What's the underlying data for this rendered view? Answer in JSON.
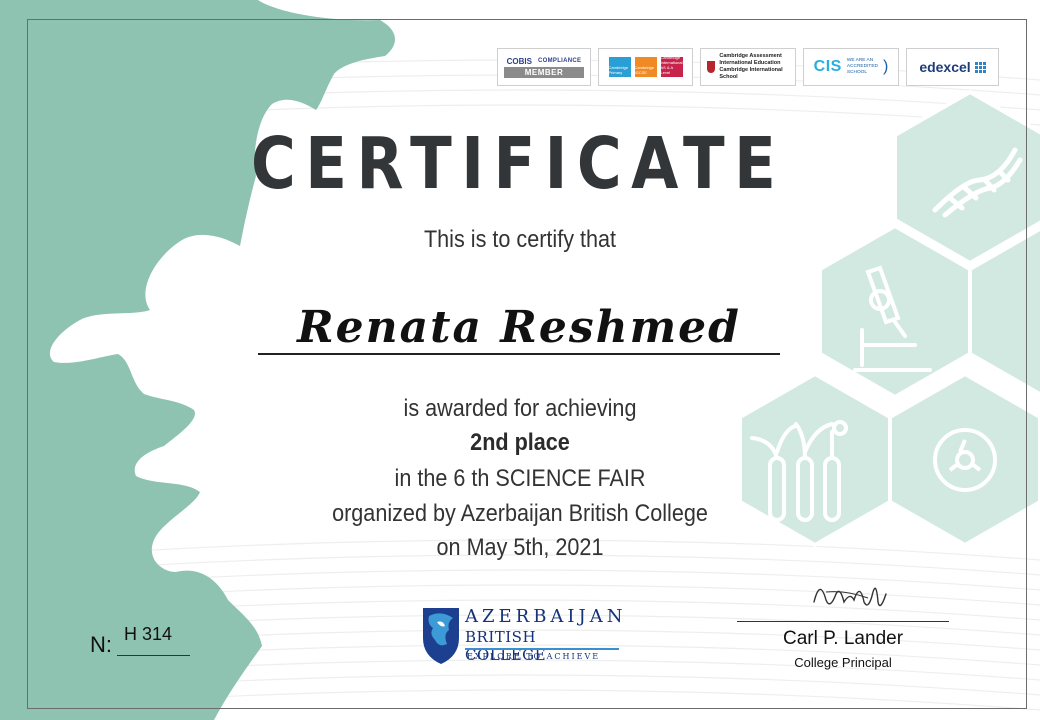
{
  "accreditations": {
    "cobis": {
      "name": "COBIS",
      "compliance": "COMPLIANCE",
      "member": "MEMBER"
    },
    "cambridge_chips": [
      "Cambridge Primary",
      "Cambridge IGCSE",
      "Cambridge International AS & A Level"
    ],
    "cambridge_assessment": {
      "line1": "Cambridge Assessment",
      "line2": "International Education",
      "line3": "Cambridge International School"
    },
    "cis": {
      "mark": "CIS",
      "line1": "WE ARE AN",
      "line2": "ACCREDITED",
      "line3": "SCHOOL",
      "paren": ")"
    },
    "edexcel": "edexcel"
  },
  "certificate": {
    "title": "CERTIFICATE",
    "intro": "This is to certify that",
    "recipient": "Renata Reshmed",
    "line1": "is awarded for achieving",
    "award": "2nd place",
    "line2": "in the 6 th SCIENCE FAIR",
    "line3": "organized by Azerbaijan British College",
    "line4": "on May 5th, 2021"
  },
  "number": {
    "label": "N:",
    "value": "H 314"
  },
  "college_logo": {
    "line1": "AZERBAIJAN",
    "line2": "BRITISH COLLEGE",
    "line3": "EXPLORE TO ACHIEVE"
  },
  "signatory": {
    "name": "Carl P. Lander",
    "role": "College Principal"
  },
  "colors": {
    "accent": "#8ec3b2",
    "hexagon": "#d2e9e1",
    "text": "#333638",
    "logo_blue": "#14317a"
  }
}
